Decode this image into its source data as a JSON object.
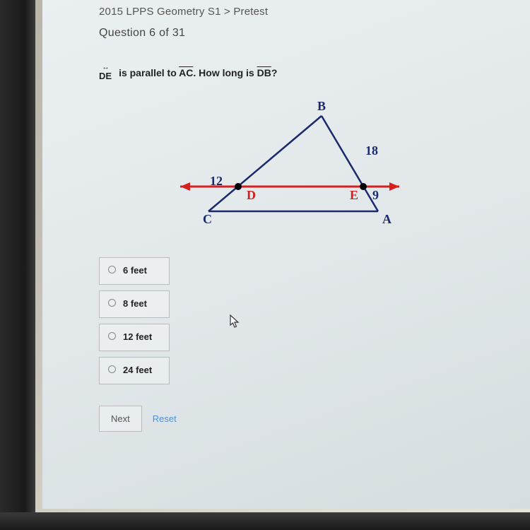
{
  "breadcrumb": "2015 LPPS Geometry S1 > Pretest",
  "question_header": "Question 6 of 31",
  "line_label_top": "↔",
  "line_label_bottom": "DE",
  "question_prefix": "is parallel to ",
  "seg_ac": "AC",
  "question_mid": ". How long is ",
  "seg_db": "DB",
  "question_suffix": "?",
  "figure": {
    "labels": {
      "B": "B",
      "C": "C",
      "A": "A",
      "D": "D",
      "E": "E"
    },
    "values": {
      "eighteen": "18",
      "twelve": "12",
      "nine": "9"
    }
  },
  "options": [
    {
      "label": "6 feet"
    },
    {
      "label": "8 feet"
    },
    {
      "label": "12 feet"
    },
    {
      "label": "24 feet"
    }
  ],
  "buttons": {
    "next": "Next",
    "reset": "Reset"
  }
}
